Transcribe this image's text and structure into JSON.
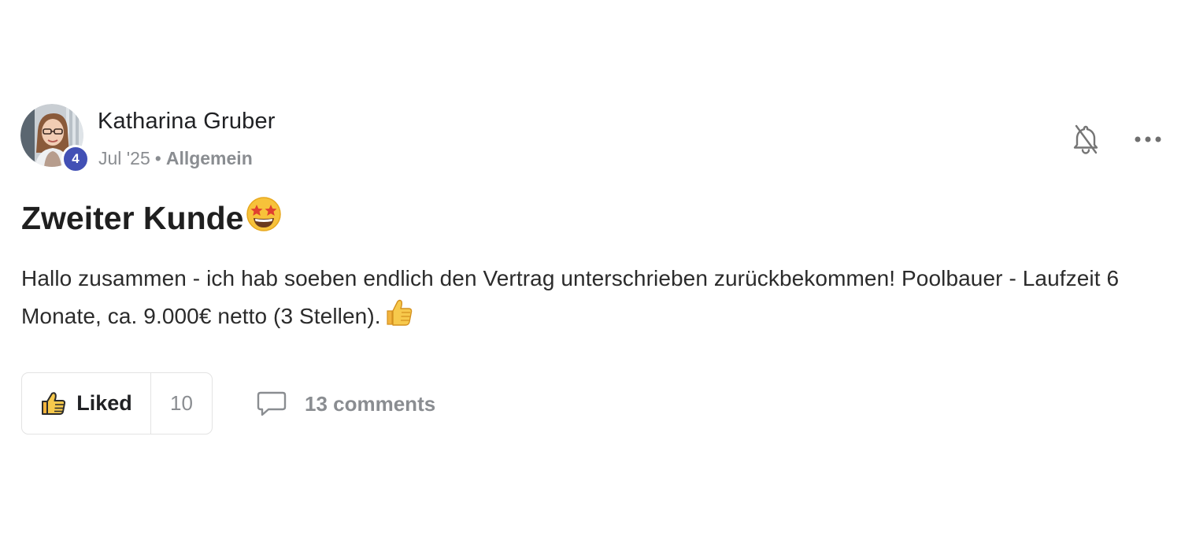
{
  "post": {
    "author": {
      "name": "Katharina Gruber",
      "level": "4"
    },
    "date": "Jul '25",
    "separator": "•",
    "category": "Allgemein",
    "title": "Zweiter Kunde",
    "title_emoji": "star-struck-emoji",
    "body_text": "Hallo zusammen - ich hab soeben endlich den Vertrag unterschrieben zurückbekommen! Poolbauer - Laufzeit 6 Monate, ca. 9.000€ netto (3 Stellen).",
    "body_emoji": "thumbs-up-emoji"
  },
  "actions": {
    "like_label": "Liked",
    "like_count": "10",
    "comments_label": "13 comments"
  },
  "icons": {
    "bell": "bell-off-icon",
    "more": "more-horizontal-icon",
    "like": "thumbs-up-icon",
    "comment": "comment-bubble-icon"
  },
  "colors": {
    "badge": "#4250b5",
    "muted_text": "#8a8d91",
    "border": "#e3e3e3",
    "emoji_yellow": "#f7c23a"
  }
}
